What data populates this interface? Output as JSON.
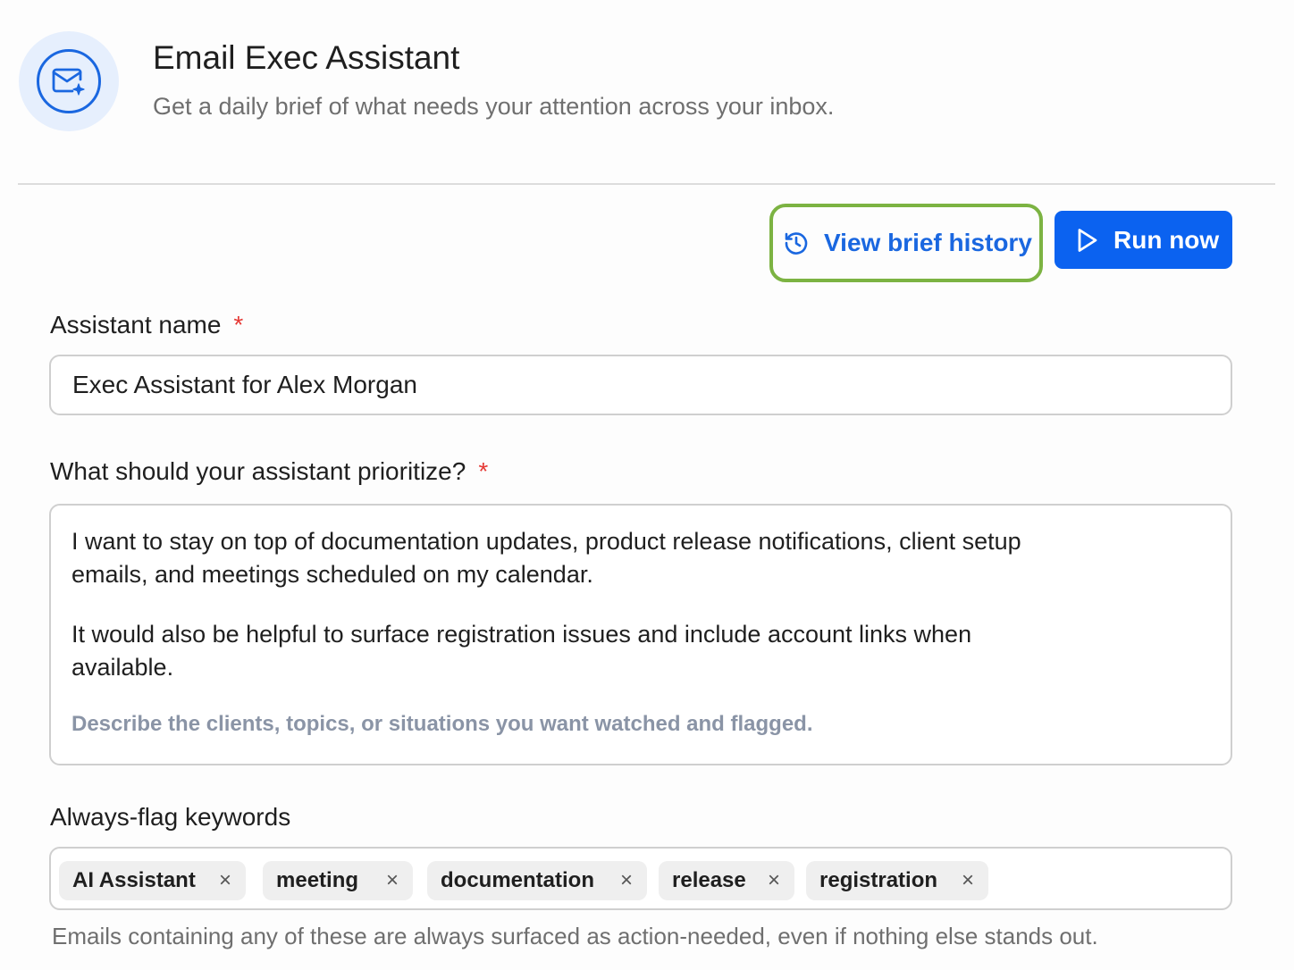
{
  "header": {
    "title": "Email Exec Assistant",
    "subtitle": "Get a daily brief of what needs your attention across your inbox.",
    "icon": "mail-sparkle-icon"
  },
  "actions": {
    "history_label": "View brief history",
    "history_icon": "history-icon",
    "run_label": "Run now",
    "run_icon": "play-icon",
    "accent_color": "#1a67e0",
    "highlight_color": "#7cb342"
  },
  "form": {
    "name_label": "Assistant name",
    "name_required": "*",
    "name_value": "Exec Assistant for Alex Morgan",
    "priority_label": "What should your assistant prioritize?",
    "priority_required": "*",
    "priority_paragraphs": [
      "I want to stay on top of documentation updates, product release notifications, client setup emails, and meetings scheduled on my calendar.",
      "It would also be helpful to surface registration issues and include account links when available."
    ],
    "priority_helper": "Describe the clients, topics, or situations you want watched and flagged.",
    "keywords_label": "Always-flag keywords",
    "keywords": [
      {
        "label": "AI Assistant",
        "remove": "×"
      },
      {
        "label": "meeting",
        "remove": "×"
      },
      {
        "label": "documentation",
        "remove": "×"
      },
      {
        "label": "release",
        "remove": "×"
      },
      {
        "label": "registration",
        "remove": "×"
      }
    ],
    "keywords_note": "Emails containing any of these are always surfaced as action-needed, even if nothing else stands out."
  }
}
